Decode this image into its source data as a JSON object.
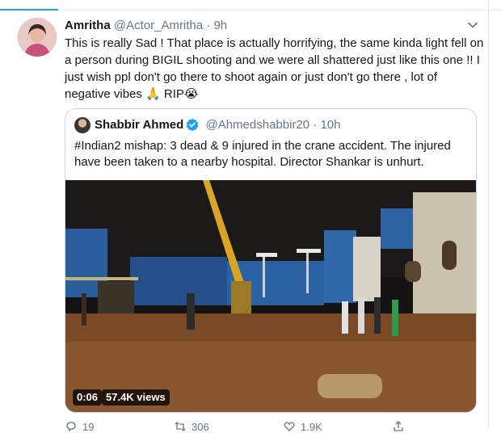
{
  "tweet": {
    "author_name": "Amritha",
    "author_handle": "@Actor_Amritha",
    "separator": "·",
    "time": "9h",
    "text": "This is really Sad ! That place is actually horrifying, the same kinda light fell on a person during BIGIL shooting and we were all shattered just like this one !! I just wish ppl don't go there to shoot again or just don't go there , lot of negative vibes 🙏 RIP😭"
  },
  "quoted": {
    "author_name": "Shabbir Ahmed",
    "author_handle": "@Ahmedshabbir20",
    "separator": "·",
    "time": "10h",
    "text": "#Indian2 mishap: 3 dead & 9 injured in the crane accident. The injured have been taken to a nearby hospital. Director Shankar is unhurt.",
    "video": {
      "duration": "0:06",
      "views": "57.4K views"
    }
  },
  "actions": {
    "reply_count": "19",
    "retweet_count": "306",
    "like_count": "1.9K"
  },
  "colors": {
    "accent": "#1da1f2",
    "muted": "#657786",
    "border": "#ccd6dd"
  },
  "icons": [
    "chevron-down-icon",
    "verified-badge-icon",
    "reply-icon",
    "retweet-icon",
    "like-icon",
    "share-icon"
  ]
}
